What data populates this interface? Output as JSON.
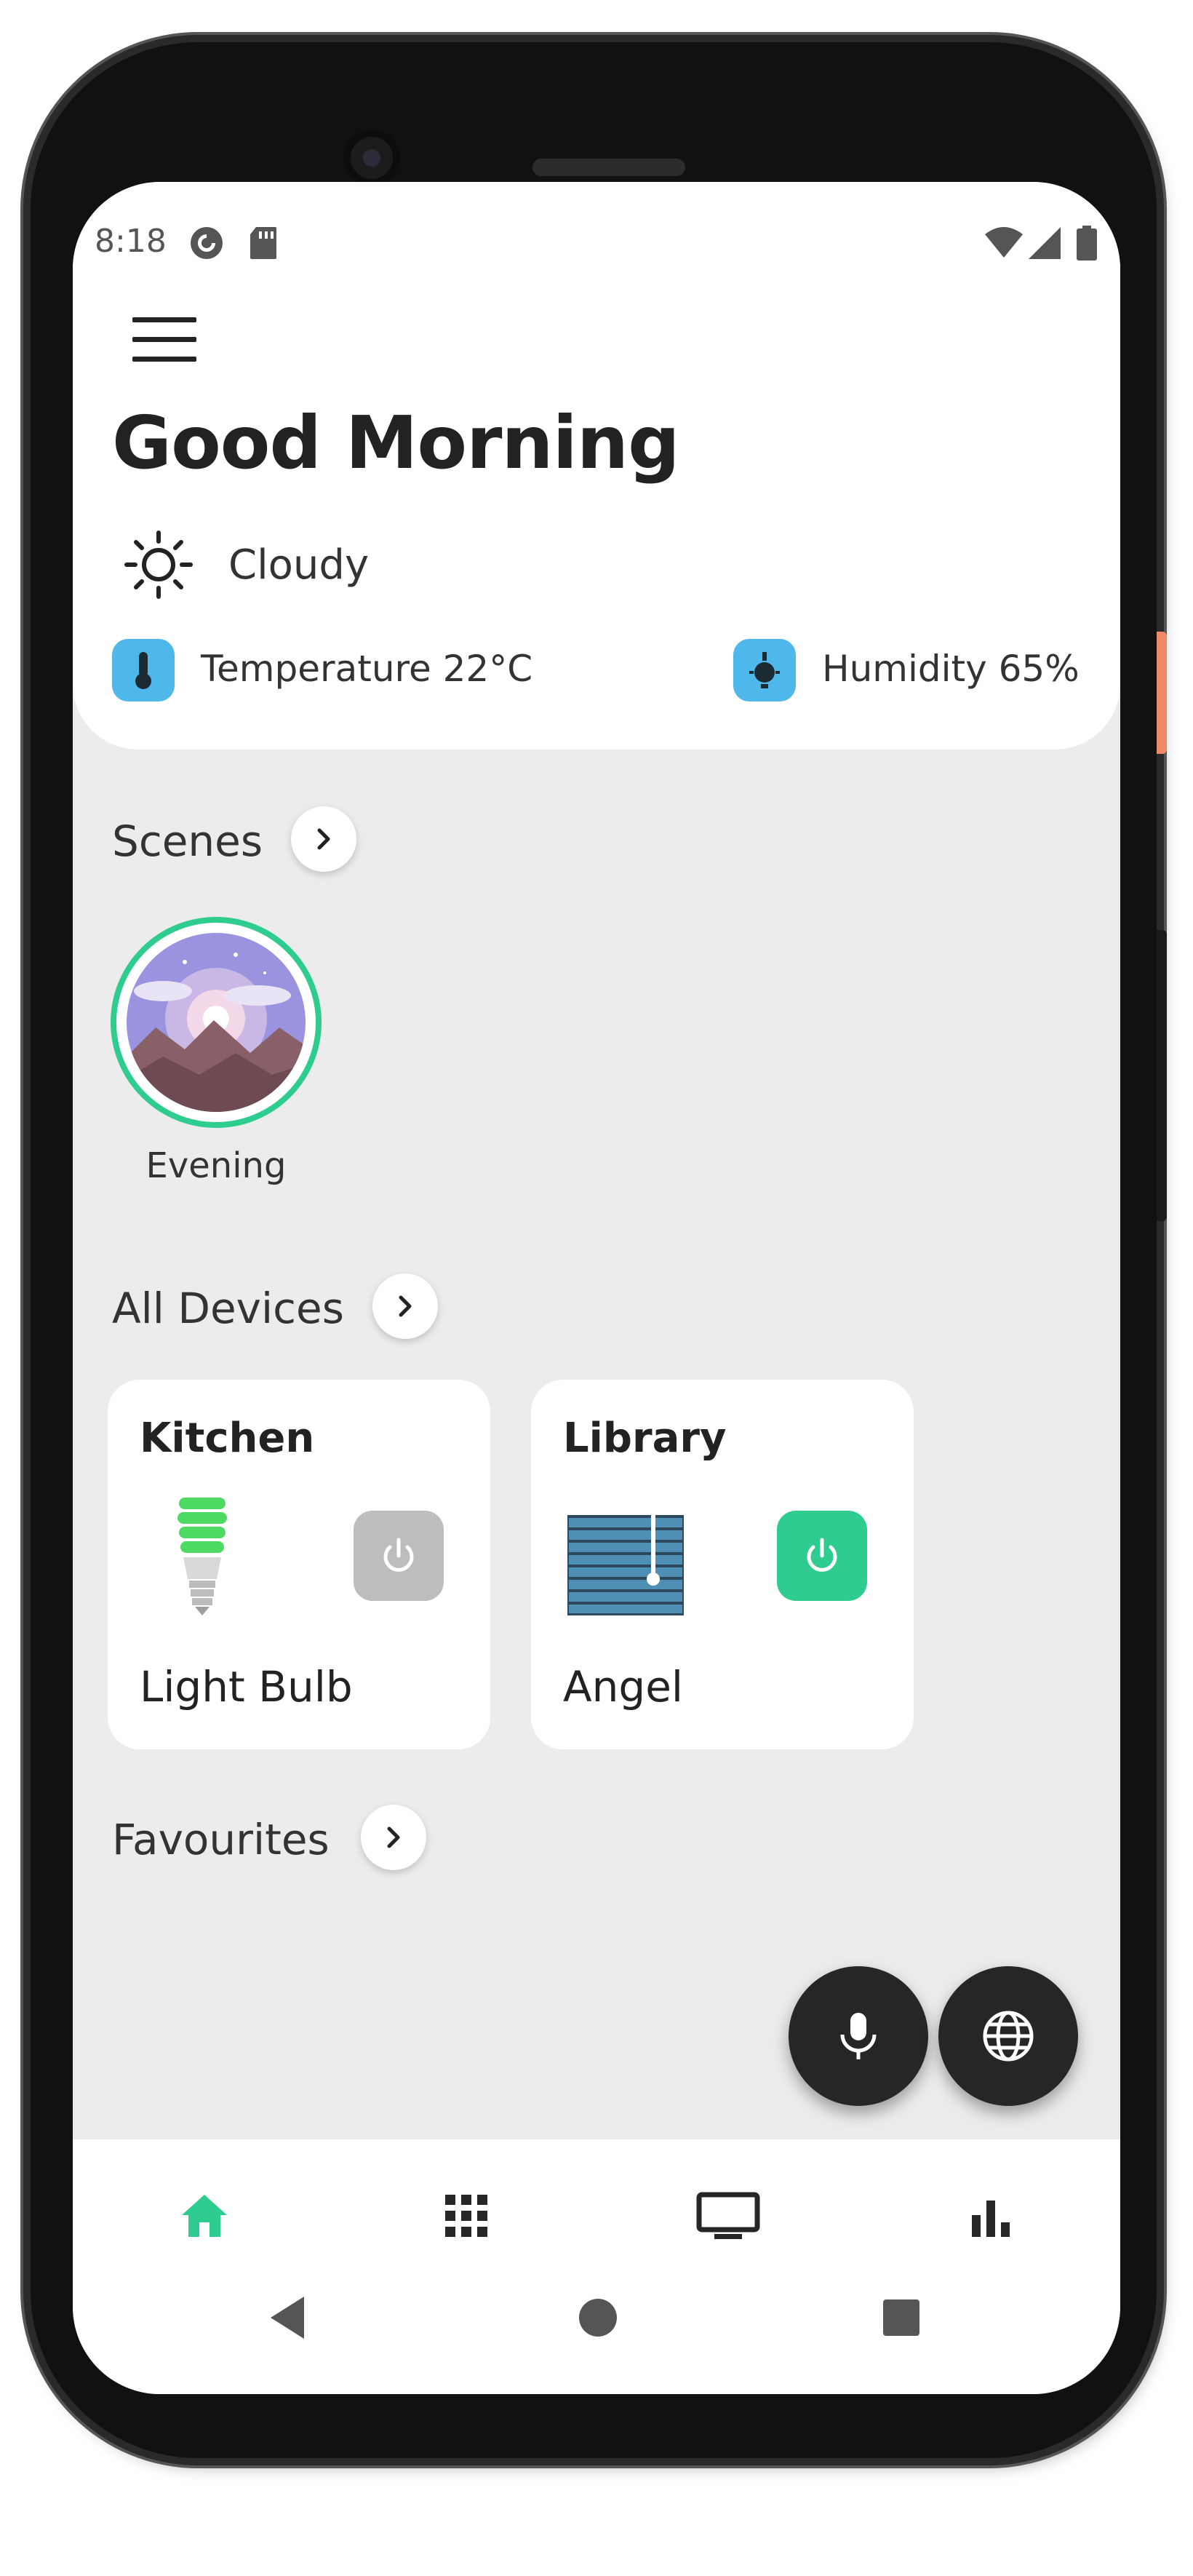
{
  "status_bar": {
    "time": "8:18"
  },
  "header": {
    "greeting": "Good Morning",
    "weather": "Cloudy",
    "temperature": "Temperature 22°C",
    "humidity": "Humidity 65%"
  },
  "scenes": {
    "title": "Scenes",
    "items": [
      {
        "label": "Evening"
      }
    ]
  },
  "devices": {
    "title": "All Devices",
    "items": [
      {
        "room": "Kitchen",
        "name": "Light Bulb",
        "power_on": false,
        "icon": "light-bulb-icon"
      },
      {
        "room": "Library",
        "name": "Angel",
        "power_on": true,
        "icon": "blinds-icon"
      }
    ]
  },
  "favourites": {
    "title": "Favourites"
  },
  "fabs": [
    "microphone-icon",
    "globe-icon"
  ],
  "bottom_nav": [
    {
      "icon": "home-icon",
      "active": true
    },
    {
      "icon": "grid-icon",
      "active": false
    },
    {
      "icon": "tv-icon",
      "active": false
    },
    {
      "icon": "bar-chart-icon",
      "active": false
    }
  ],
  "colors": {
    "accent": "#2ecc8f",
    "sensor_badge": "#4fb8ea",
    "power_off": "#bdbdbd",
    "background": "#ececec"
  }
}
